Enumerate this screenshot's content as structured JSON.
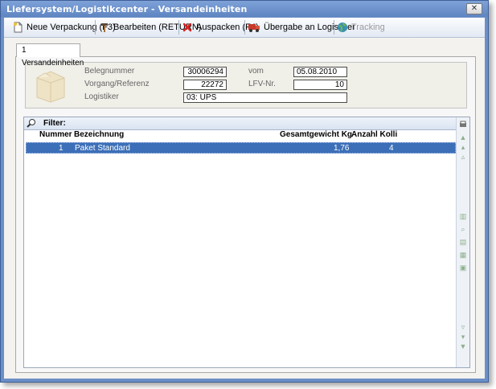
{
  "window": {
    "title": "Liefersystem/Logistikcenter - Versandeinheiten",
    "close_label": "✕"
  },
  "toolbar": {
    "new_package": "Neue Verpackung (F3)",
    "edit": "Bearbeiten (RETURN)",
    "unpack": "Auspacken (F4)",
    "handover": "Übergabe an Logistiker",
    "tracking": "Tracking"
  },
  "tab": {
    "label": "1 Versandeinheiten"
  },
  "info": {
    "belegnummer_label": "Belegnummer",
    "belegnummer_value": "30006294",
    "vom_label": "vom",
    "vom_value": "05.08.2010",
    "vorgang_label": "Vorgang/Referenz",
    "vorgang_value": "22272",
    "lfv_label": "LFV-Nr.",
    "lfv_value": "10",
    "logistiker_label": "Logistiker",
    "logistiker_value": "03: UPS"
  },
  "grid": {
    "filter_label": "Filter:",
    "columns": {
      "nummer": "Nummer",
      "bezeichnung": "Bezeichnung",
      "gewicht": "Gesamtgewicht Kg",
      "kolli": "Anzahl Kolli"
    },
    "rows": [
      {
        "nummer": "1",
        "bezeichnung": "Paket Standard",
        "gewicht": "1,76",
        "kolli": "4"
      }
    ]
  },
  "colors": {
    "titlebar": "#6b8fc7",
    "selection": "#3c6fb8"
  }
}
